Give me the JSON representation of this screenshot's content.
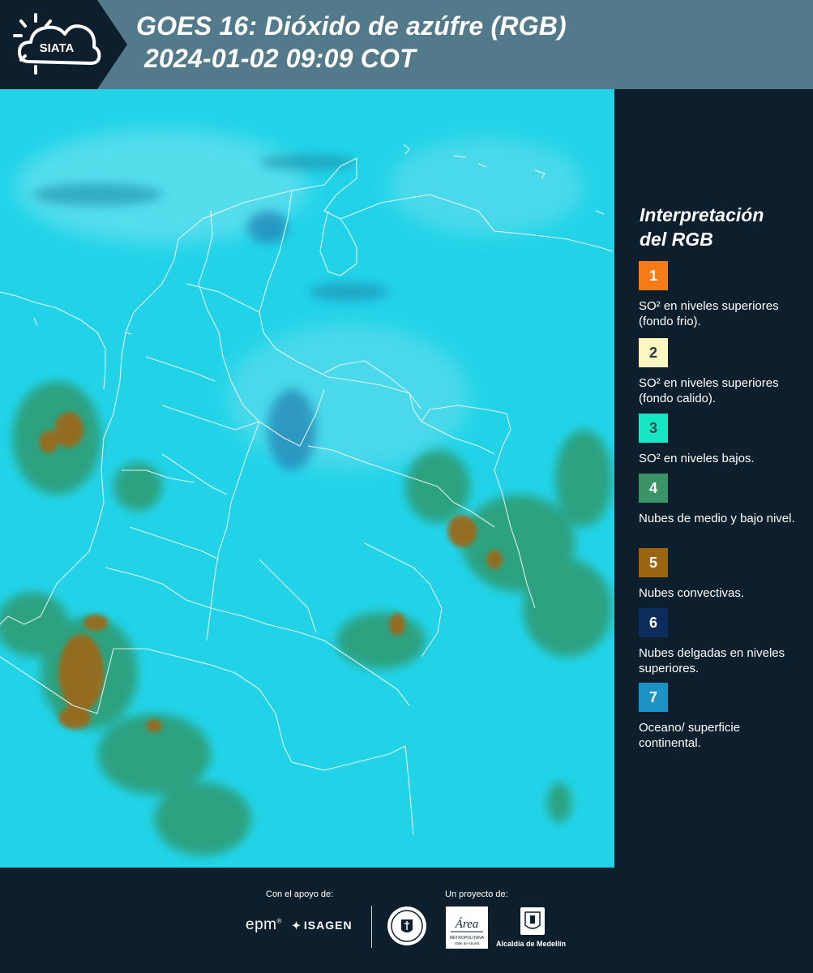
{
  "header": {
    "logo_text": "SIATA",
    "title_line1": "GOES 16: Dióxido de azúfre (RGB)",
    "title_line2": "2024-01-02 09:09 COT"
  },
  "legend": {
    "title_line1": "Interpretación",
    "title_line2": "del RGB",
    "items": [
      {
        "number": "1",
        "color": "#f57c16",
        "label": "SO² en niveles superiores (fondo frio)."
      },
      {
        "number": "2",
        "color": "#fcf6c0",
        "label": "SO² en niveles superiores (fondo calido)."
      },
      {
        "number": "3",
        "color": "#17e6c4",
        "label": "SO² en niveles bajos."
      },
      {
        "number": "4",
        "color": "#3a9468",
        "label": "Nubes de medio y bajo nivel."
      },
      {
        "number": "5",
        "color": "#9a6410",
        "label": "Nubes convectivas."
      },
      {
        "number": "6",
        "color": "#0c2c5e",
        "label": "Nubes delgadas en niveles superiores."
      },
      {
        "number": "7",
        "color": "#1b93c4",
        "label": "Oceano/ superficie continental."
      }
    ]
  },
  "footer": {
    "support_label": "Con el apoyo de:",
    "project_label": "Un proyecto de:",
    "epm": "epm",
    "isagen": "ISAGEN",
    "area_text": "Área",
    "area_sub": "METROPOLITANA",
    "area_sub2": "Valle de Aburrá",
    "alcaldia": "Alcaldía de Medellín"
  },
  "colors": {
    "background": "#0d1f2c",
    "header_band": "#527a8a",
    "ocean_cyan": "#20d4e6",
    "cloud_green": "#3a9468",
    "cloud_brown": "#9a6410"
  }
}
